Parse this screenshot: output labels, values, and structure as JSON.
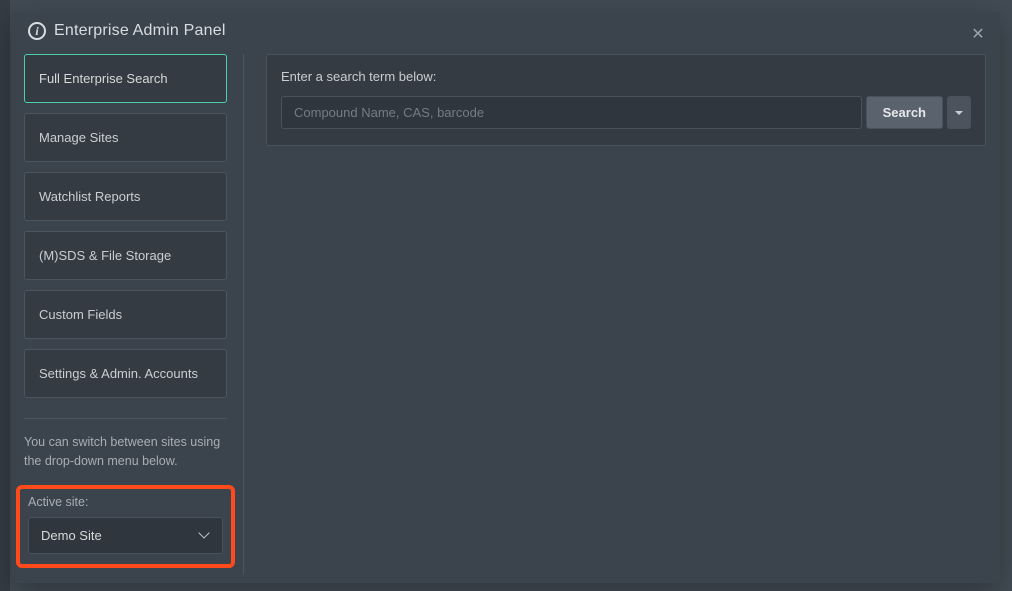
{
  "header": {
    "title": "Enterprise Admin Panel"
  },
  "sidebar": {
    "items": [
      {
        "label": "Full Enterprise Search",
        "active": true
      },
      {
        "label": "Manage Sites"
      },
      {
        "label": "Watchlist Reports"
      },
      {
        "label": "(M)SDS & File Storage"
      },
      {
        "label": "Custom Fields"
      },
      {
        "label": "Settings & Admin. Accounts"
      }
    ],
    "switch_hint": "You can switch between sites using the drop-down menu below.",
    "active_site_label": "Active site:",
    "active_site_value": "Demo Site"
  },
  "search": {
    "prompt": "Enter a search term below:",
    "placeholder": "Compound Name, CAS, barcode",
    "button_label": "Search"
  }
}
